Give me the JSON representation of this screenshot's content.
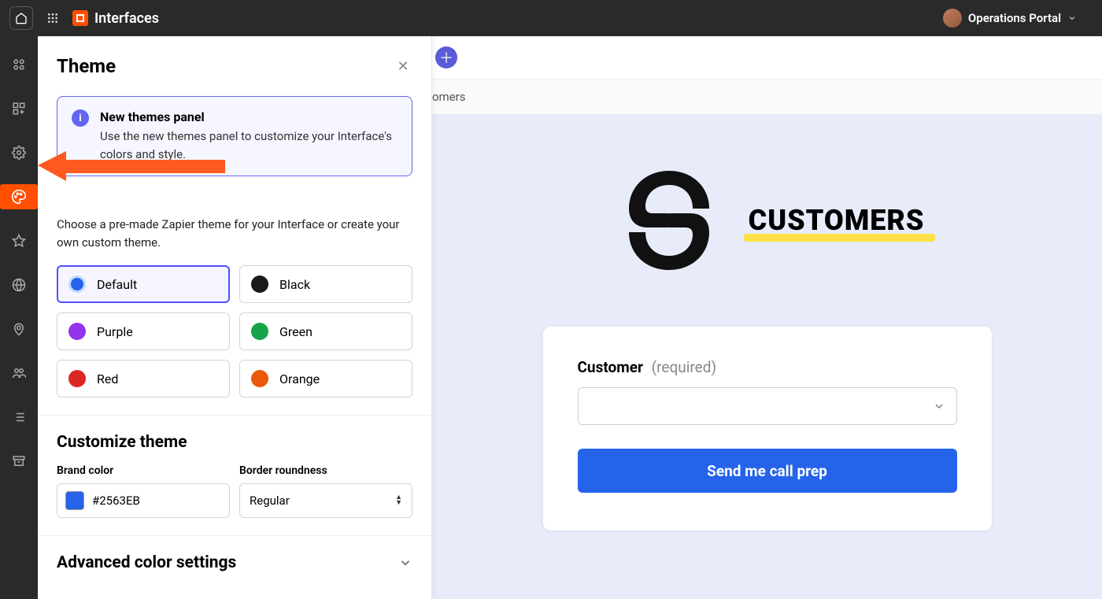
{
  "topbar": {
    "title": "Interfaces",
    "workspace_name": "Operations Portal"
  },
  "theme_panel": {
    "title": "Theme",
    "banner": {
      "title": "New themes panel",
      "body": "Use the new themes panel to customize your Interface's colors and style."
    },
    "chooser_desc": "Choose a pre-made Zapier theme for your Interface or create your own custom theme.",
    "options": [
      {
        "label": "Default",
        "swatch_class": "sw-default",
        "selected": true
      },
      {
        "label": "Black",
        "swatch_class": "sw-black"
      },
      {
        "label": "Purple",
        "swatch_class": "sw-purple"
      },
      {
        "label": "Green",
        "swatch_class": "sw-green"
      },
      {
        "label": "Red",
        "swatch_class": "sw-red"
      },
      {
        "label": "Orange",
        "swatch_class": "sw-orange"
      }
    ],
    "customize_title": "Customize theme",
    "brand_color_label": "Brand color",
    "brand_color_value": "#2563EB",
    "border_roundness_label": "Border roundness",
    "border_roundness_value": "Regular",
    "advanced_title": "Advanced color settings"
  },
  "main": {
    "crumb": "omers",
    "hero_title": "CUSTOMERS",
    "form": {
      "field_label": "Customer",
      "field_required": "(required)",
      "submit_label": "Send me call prep"
    }
  }
}
